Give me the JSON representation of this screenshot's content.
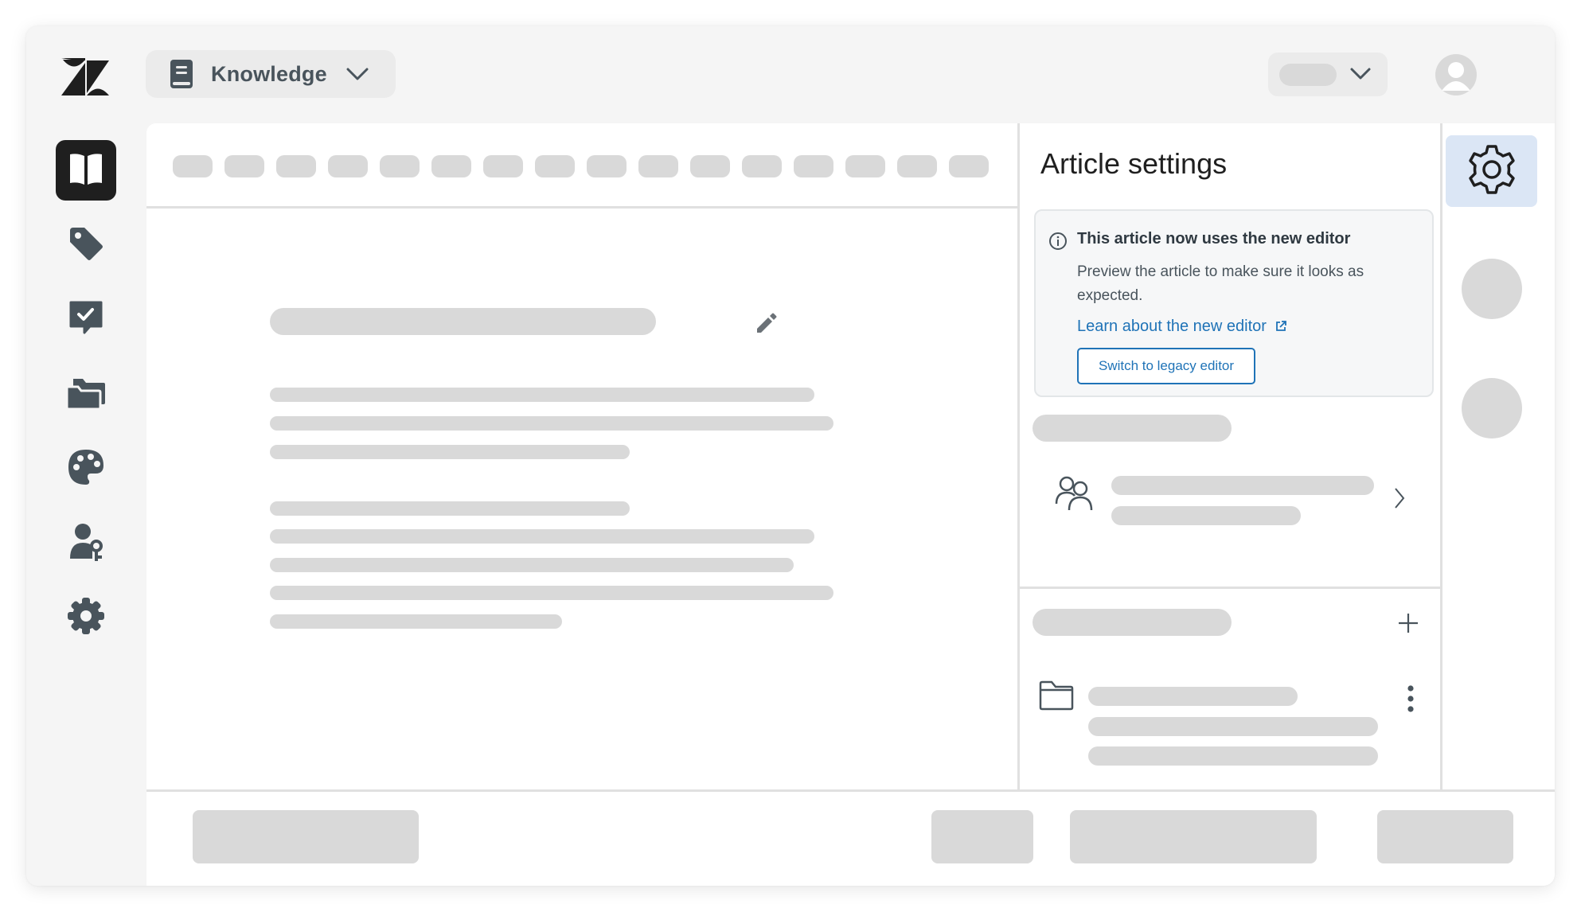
{
  "header": {
    "product_name": "Knowledge",
    "product_icon": "book-icon",
    "logo_icon": "zendesk-logo-icon",
    "user_icon": "user-avatar-icon"
  },
  "nav": {
    "items": [
      {
        "name": "articles",
        "icon": "open-book-icon",
        "active": true
      },
      {
        "name": "tags",
        "icon": "tag-icon",
        "active": false
      },
      {
        "name": "approvals",
        "icon": "checked-speech-bubble-icon",
        "active": false
      },
      {
        "name": "folders",
        "icon": "folders-icon",
        "active": false
      },
      {
        "name": "themes",
        "icon": "palette-icon",
        "active": false
      },
      {
        "name": "user-permissions",
        "icon": "user-key-icon",
        "active": false
      },
      {
        "name": "settings",
        "icon": "gear-icon",
        "active": false
      }
    ]
  },
  "settings_panel": {
    "title": "Article settings",
    "notice": {
      "icon": "info-circle-icon",
      "title": "This article now uses the new editor",
      "body": "Preview the article to make sure it looks as expected.",
      "link_label": "Learn about the new editor",
      "link_icon": "external-link-icon",
      "button_label": "Switch to legacy editor"
    },
    "permissions_icon": "users-icon",
    "section_icons": [
      "chevron-right-icon",
      "plus-icon",
      "folder-icon",
      "kebab-menu-icon"
    ]
  },
  "right_rail": {
    "active_tab_icon": "gear-icon"
  },
  "colors": {
    "accent": "#1f73b7",
    "skeleton": "#d9d9d9",
    "active_nav": "#1f1f1f",
    "active_tab": "#dbe6f5",
    "nav_icon": "#49545c"
  }
}
